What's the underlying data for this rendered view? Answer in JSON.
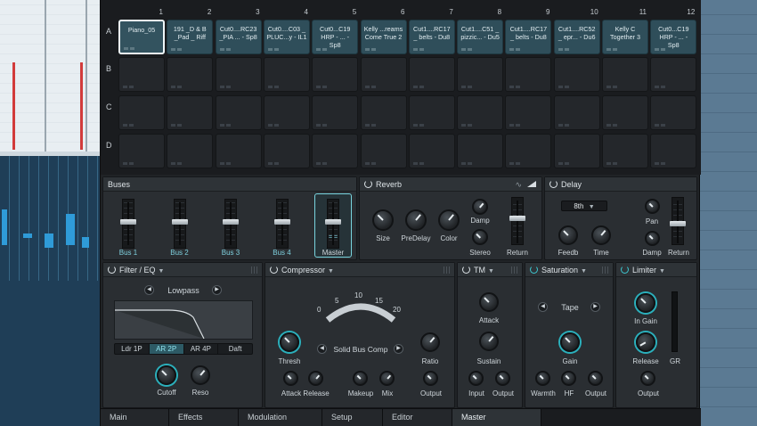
{
  "grid": {
    "columns": [
      "1",
      "2",
      "3",
      "4",
      "5",
      "6",
      "7",
      "8",
      "9",
      "10",
      "11",
      "12"
    ],
    "rows": [
      "A",
      "B",
      "C",
      "D"
    ],
    "row_a_pads": [
      "Piano_05",
      "191 _D & B\n_Pad _ Riff",
      "Cut0....RC23\n_PIA ... - Sp8",
      "Cut0....C03 _\nPLUC...y - IL1",
      "Cut0...C19\nHRP - ... - Sp8",
      "Kelly ...reams\nCome True 2",
      "Cut1....RC17\n_ belts - Du8",
      "Cut1....C51 _\npizzic... - Du5",
      "Cut1....RC17\n_ belts - Du8",
      "Cut1....RC52\n_ epr... - Du6",
      "Kelly C\nTogether 3",
      "Cut0...C19\nHRP - ... - Sp8"
    ]
  },
  "buses": {
    "title": "Buses",
    "channels": [
      "Bus 1",
      "Bus 2",
      "Bus 3",
      "Bus 4",
      "Master"
    ],
    "master_fader_value": "= ="
  },
  "reverb": {
    "title": "Reverb",
    "knobs": [
      "Size",
      "PreDelay",
      "Color",
      "Damp",
      "Stereo"
    ],
    "return_label": "Return"
  },
  "delay": {
    "title": "Delay",
    "sync_value": "8th",
    "knobs": [
      "Feedb",
      "Time",
      "Pan",
      "Damp"
    ],
    "return_label": "Return"
  },
  "filter": {
    "title": "Filter / EQ",
    "type_value": "Lowpass",
    "modes": [
      "Ldr 1P",
      "AR 2P",
      "AR 4P",
      "Daft"
    ],
    "selected_mode": "AR 2P",
    "knobs": [
      "Cutoff",
      "Reso"
    ]
  },
  "compressor": {
    "title": "Compressor",
    "meter_scale": [
      "0",
      "5",
      "10",
      "15",
      "20"
    ],
    "preset": "Solid Bus Comp",
    "knobs": [
      "Thresh",
      "Ratio",
      "Attack",
      "Release",
      "Makeup",
      "Mix",
      "Output"
    ]
  },
  "tm": {
    "title": "TM",
    "knobs": [
      "Attack",
      "Sustain",
      "Input",
      "Output"
    ]
  },
  "saturation": {
    "title": "Saturation",
    "mode": "Tape",
    "knobs": [
      "Gain",
      "Warmth",
      "HF",
      "Output"
    ]
  },
  "limiter": {
    "title": "Limiter",
    "knobs": [
      "In Gain",
      "Release",
      "Output"
    ],
    "meter_label": "GR"
  },
  "tabs": [
    "Main",
    "Effects",
    "Modulation",
    "Setup",
    "Editor",
    "Master"
  ],
  "active_tab": "Master",
  "colors": {
    "accent": "#3cc6cf",
    "pad_filled": "#2f4e5a",
    "panel": "#2a2e32"
  }
}
